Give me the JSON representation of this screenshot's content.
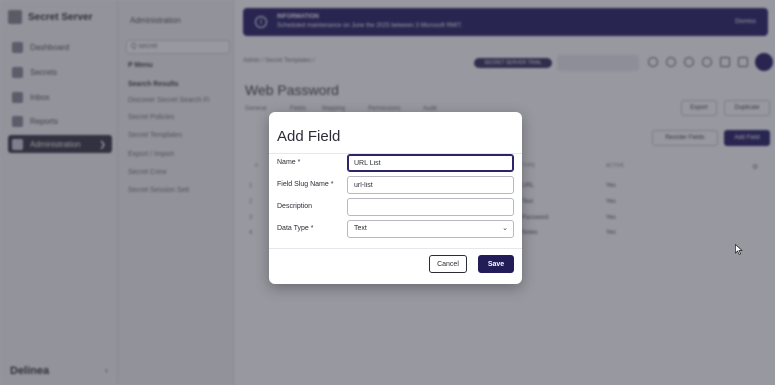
{
  "app": {
    "name": "Secret Server",
    "vendor": "Delinea",
    "nav_items": [
      {
        "label": "Dashboard",
        "icon": "dashboard-icon"
      },
      {
        "label": "Secrets",
        "icon": "lock-icon"
      },
      {
        "label": "Inbox",
        "icon": "inbox-icon"
      },
      {
        "label": "Reports",
        "icon": "reports-icon"
      },
      {
        "label": "Administration",
        "icon": "gear-icon"
      }
    ]
  },
  "admin_panel": {
    "title": "Administration",
    "search_value": "Q secret",
    "links": [
      "P Menu",
      "Search Results",
      "Discover Secret Search Fi",
      "Secret Policies",
      "Secret Templates",
      "Export / Import",
      "Secret Crew",
      "Secret Session Seti"
    ]
  },
  "banner": {
    "title": "INFORMATION",
    "text": "Scheduled maintenance on June the 2025 between 3 Microsoft RMIT.",
    "dismiss": "Dismiss"
  },
  "breadcrumb": "Admin / Secret Templates /",
  "header_pill": "SECRET SERVER TRIAL",
  "page_title": "Web Password",
  "tabs": [
    "General",
    "Fields",
    "Mapping",
    "Permissions",
    "Audit"
  ],
  "page_buttons": {
    "export": "Export",
    "duplicate": "Duplicate",
    "reorder": "Reorder Fields",
    "add_field": "Add Field"
  },
  "background_table": {
    "headers": [
      "#",
      "TYPE",
      "ACTIVE"
    ],
    "rows": [
      {
        "num": "1",
        "type": "URL",
        "active": "Yes"
      },
      {
        "num": "2",
        "type": "Text",
        "active": "Yes"
      },
      {
        "num": "3",
        "type": "Password",
        "active": "Yes"
      },
      {
        "num": "4",
        "type": "Notes",
        "active": "Yes"
      }
    ]
  },
  "modal": {
    "title": "Add Field",
    "fields": {
      "name_label": "Name *",
      "name_value": "URL List",
      "slug_label": "Field Slug Name *",
      "slug_value": "url-list",
      "description_label": "Description",
      "description_value": "",
      "data_type_label": "Data Type *",
      "data_type_value": "Text"
    },
    "cancel_label": "Cancel",
    "save_label": "Save"
  },
  "colors": {
    "brand": "#221c58",
    "overlay": "rgba(40,40,56,0.48)"
  }
}
